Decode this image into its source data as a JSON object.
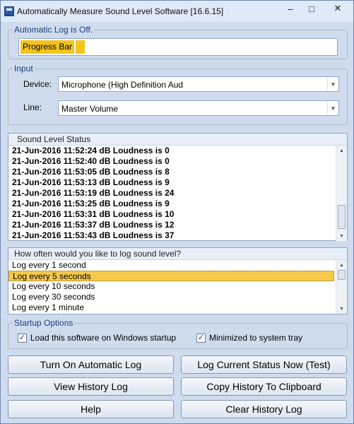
{
  "window": {
    "title": "Automatically Measure Sound Level Software [16.6.15]",
    "minimize": "–",
    "maximize": "□",
    "close": "✕"
  },
  "log_group": {
    "legend": "Automatic Log is Off.",
    "progress_label": "Progress Bar"
  },
  "input_group": {
    "legend": "Input",
    "device_label": "Device:",
    "device_value": "Microphone (High Definition Aud",
    "line_label": "Line:",
    "line_value": "Master Volume"
  },
  "status_list": {
    "header": "Sound Level Status",
    "rows": [
      "21-Jun-2016 11:52:24 dB Loudness is 0",
      "21-Jun-2016 11:52:40 dB Loudness is 0",
      "21-Jun-2016 11:53:05 dB Loudness is 8",
      "21-Jun-2016 11:53:13 dB Loudness is 9",
      "21-Jun-2016 11:53:19 dB Loudness is 24",
      "21-Jun-2016 11:53:25 dB Loudness is 9",
      "21-Jun-2016 11:53:31 dB Loudness is 10",
      "21-Jun-2016 11:53:37 dB Loudness is 12",
      "21-Jun-2016 11:53:43 dB Loudness is 37"
    ]
  },
  "interval_list": {
    "header": "How often would you like to log sound level?",
    "rows": [
      "Log every 1 second",
      "Log every 5 seconds",
      "Log every 10 seconds",
      "Log every 30 seconds",
      "Log every 1 minute"
    ],
    "selected": "Log every 5 seconds"
  },
  "startup_group": {
    "legend": "Startup Options",
    "load_on_startup_label": "Load this software on Windows startup",
    "load_on_startup_checked": true,
    "minimized_label": "Minimized to system tray",
    "minimized_checked": true,
    "check_mark": "✓"
  },
  "buttons": {
    "turn_on": "Turn On Automatic Log",
    "log_now": "Log Current Status Now (Test)",
    "view_history": "View History Log",
    "copy_history": "Copy History To Clipboard",
    "help": "Help",
    "clear_history": "Clear History Log"
  },
  "icons": {
    "combo_arrow": "▼",
    "scroll_up": "▲",
    "scroll_down": "▼"
  },
  "colors": {
    "accent": "#f2c41d",
    "selection": "#f6c94c",
    "legend_text": "#1a3f7a"
  }
}
